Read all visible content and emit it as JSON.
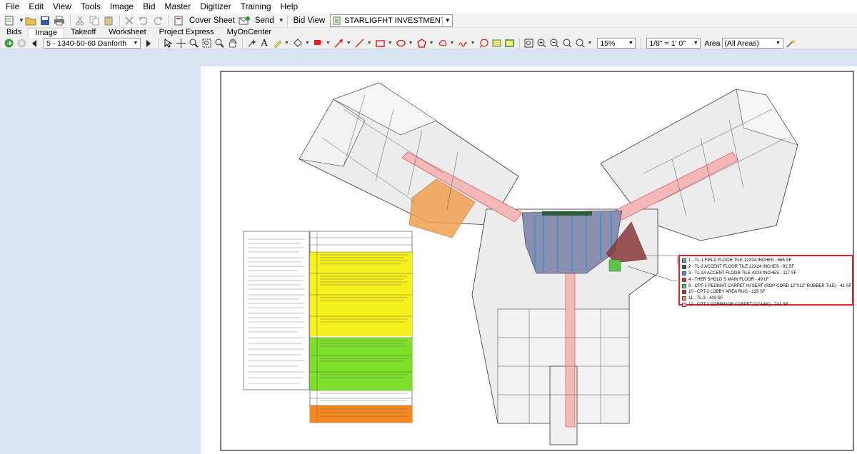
{
  "menu": [
    "File",
    "Edit",
    "View",
    "Tools",
    "Image",
    "Bid",
    "Master",
    "Digitizer",
    "Training",
    "Help"
  ],
  "toolbar": {
    "cover_sheet_label": "Cover Sheet",
    "send_label": "Send",
    "bid_view_label": "Bid View",
    "bid_view_value": "STARLIGFHT INVESTMENTS"
  },
  "tabs": [
    {
      "label": "Bids",
      "active": false
    },
    {
      "label": "Image",
      "active": true
    },
    {
      "label": "Takeoff",
      "active": false
    },
    {
      "label": "Worksheet",
      "active": false
    },
    {
      "label": "Project Express",
      "active": false
    },
    {
      "label": "MyOnCenter",
      "active": false
    }
  ],
  "toolbar2": {
    "page_value": "5 - 1340-50-60 Danforth",
    "zoom_value": "15%",
    "scale_value": "1/8\" = 1' 0\"",
    "area_label": "Area",
    "area_value": "(All Areas)"
  },
  "legend": [
    {
      "text": "1 - TL-1 FIELD FLOOR TILE 12X24 INCHES - 665 SF",
      "color": "#8a8fb0"
    },
    {
      "text": "2 - TL-2 ACCENT FLOOR TILE 12X24 INCHES - 81 SF",
      "color": "#2e5f3a"
    },
    {
      "text": "3 - TL-2A ACCENT FLOOR TILE 4X24 INCHES - 117 SF",
      "color": "#4a90c8"
    },
    {
      "text": "4 - THER SHOLD S MAIN FLOOR - 49 LF",
      "color": "#e0302a"
    },
    {
      "text": "9 - CPT-3 PEDIMAT CARPET IN SERT (ROP-CORD 12\"X12\" RUBBER TILE) - 41 SF",
      "color": "#5ec24a"
    },
    {
      "text": "10 - CPT-2 LOBBY AREA RUG - 133 SF",
      "color": "#8a3a3a"
    },
    {
      "text": "11 - TL-3 - 403 SF",
      "color": "#f0a050"
    },
    {
      "text": "12 - CPT-1 CORRIDOR CARPET(12\"X48\") - 741 SF",
      "color": "#f5b8b8"
    }
  ],
  "colors": {
    "canvas_bg": "#d9e4f2",
    "legend_border": "#e8202a",
    "corridor": "#f5b8b8",
    "tile_field": "#8a8fb0",
    "tile_accent": "#4a90c8",
    "rug": "#8a3a3a",
    "tl3": "#f0a050",
    "carpet_insert": "#5ec24a",
    "schedule_yellow": "#f5f01e",
    "schedule_green": "#7ee02a",
    "schedule_orange": "#f5881e"
  }
}
